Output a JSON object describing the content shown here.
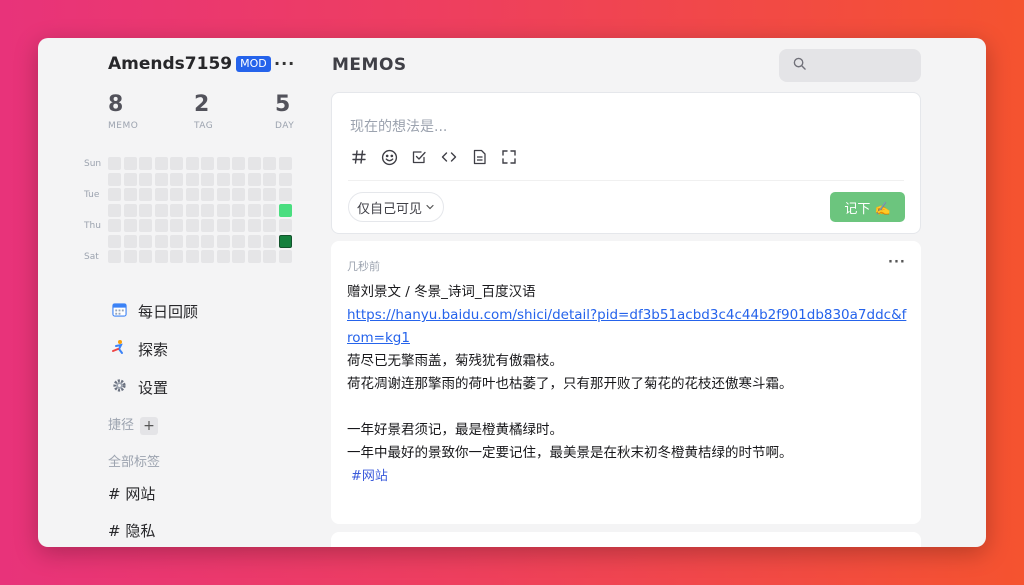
{
  "user": {
    "name": "Amends7159",
    "badge": "MOD",
    "more": "···"
  },
  "stats": [
    {
      "value": "8",
      "label": "MEMO"
    },
    {
      "value": "2",
      "label": "TAG"
    },
    {
      "value": "5",
      "label": "DAY"
    }
  ],
  "heatmap": {
    "day_labels": [
      "Sun",
      "Tue",
      "Thu",
      "Sat"
    ],
    "columns": 12,
    "rows": 7,
    "active": [
      {
        "col": 11,
        "row": 3,
        "level": 1,
        "color": "#4ade80"
      },
      {
        "col": 11,
        "row": 5,
        "level": 3,
        "color": "#15803d"
      }
    ],
    "empty_color": "#e5e5e7"
  },
  "nav": [
    {
      "label": "每日回顾",
      "icon": "calendar-icon"
    },
    {
      "label": "探索",
      "icon": "explore-icon"
    },
    {
      "label": "设置",
      "icon": "gear-icon"
    }
  ],
  "shortcuts_label": "捷径",
  "tags_label": "全部标签",
  "tags": [
    "# 网站",
    "# 隐私"
  ],
  "header": {
    "title": "MEMOS"
  },
  "search": {
    "placeholder": ""
  },
  "editor": {
    "placeholder": "现在的想法是...",
    "toolbar": [
      "hash-icon",
      "emoji-icon",
      "checkbox-icon",
      "code-icon",
      "file-icon",
      "fullscreen-icon"
    ],
    "visibility": "仅自己可见",
    "submit": "记下 ✍️"
  },
  "memo": {
    "time": "几秒前",
    "more": "···",
    "title_line": "赠刘景文 / 冬景_诗词_百度汉语",
    "link": "https://hanyu.baidu.com/shici/detail?pid=df3b51acbd3c4c44b2f901db830a7ddc&from=kg1",
    "lines": [
      "荷尽已无擎雨盖，菊残犹有傲霜枝。",
      "荷花凋谢连那擎雨的荷叶也枯萎了，只有那开败了菊花的花枝还傲寒斗霜。",
      "",
      "一年好景君须记，最是橙黄橘绿时。",
      "一年中最好的景致你一定要记住，最美景是在秋末初冬橙黄桔绿的时节啊。"
    ],
    "tag": "#网站"
  },
  "colors": {
    "accent": "#2563eb",
    "submit": "#6cc57e",
    "heat_low": "#4ade80",
    "heat_high": "#15803d"
  }
}
